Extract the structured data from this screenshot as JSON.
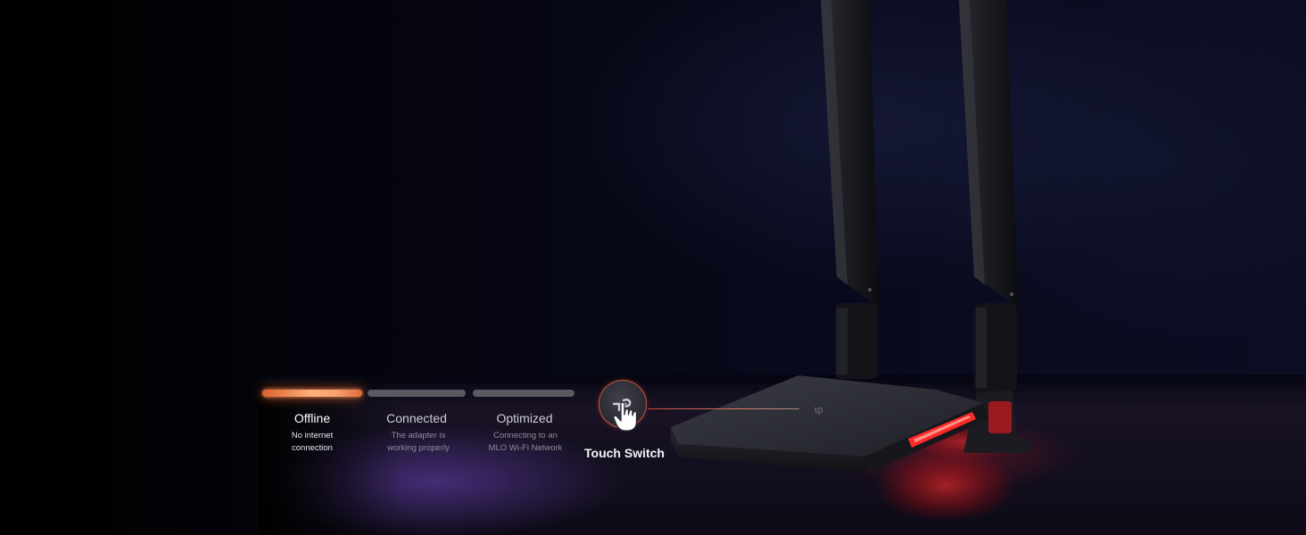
{
  "statuses": [
    {
      "title": "Offline",
      "description_line1": "No internet",
      "description_line2": "connection",
      "active": true
    },
    {
      "title": "Connected",
      "description_line1": "The adapter is",
      "description_line2": "working properly",
      "active": false
    },
    {
      "title": "Optimized",
      "description_line1": "Connecting to an",
      "description_line2": "MLO Wi-Fi Network",
      "active": false
    }
  ],
  "touch_switch": {
    "label": "Touch Switch",
    "icon": "tp-link-logo-icon"
  },
  "colors": {
    "active_bar": "#f08a52",
    "inactive_bar": "#5b5a62",
    "led_red": "#ff2a2a",
    "background": "#050611"
  }
}
